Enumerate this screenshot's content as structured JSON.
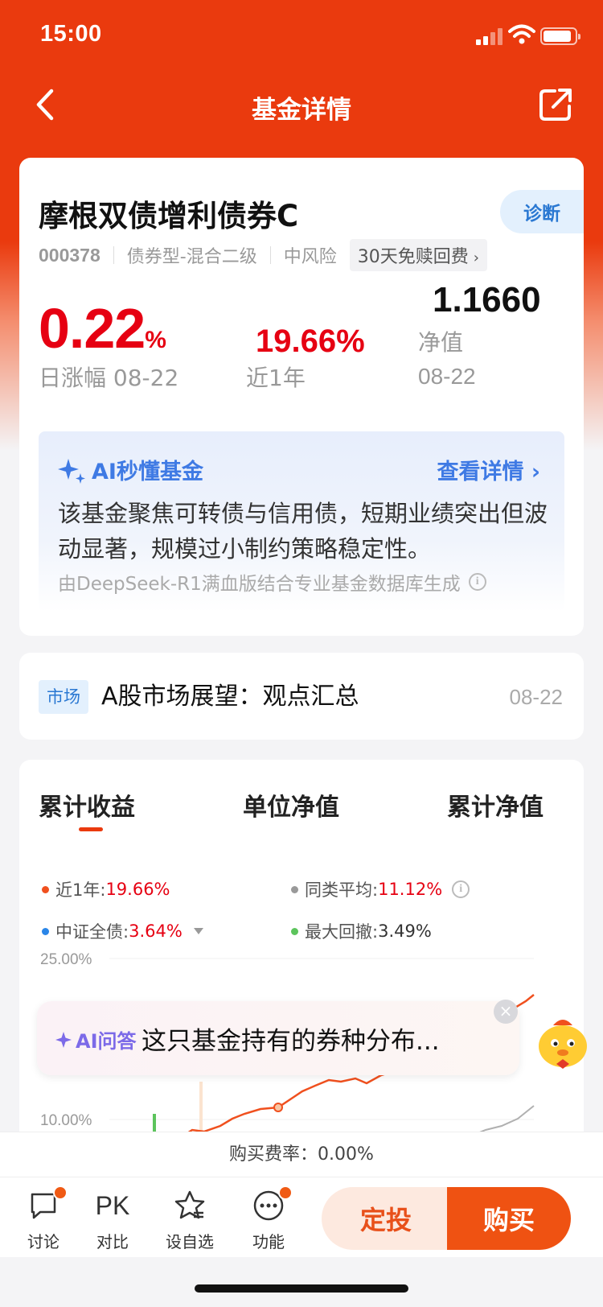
{
  "status_bar": {
    "time": "15:00"
  },
  "nav": {
    "title": "基金详情"
  },
  "fund": {
    "name": "摩根双债增利债券C",
    "diagnose_label": "诊断",
    "code": "000378",
    "type": "债券型-混合二级",
    "risk": "中风险",
    "fee_tag": "30天免赎回费",
    "daily_change": "0.22",
    "daily_change_unit": "%",
    "daily_change_label": "日涨幅 08-22",
    "year_return": "19.66%",
    "year_return_label": "近1年",
    "nav_value": "1.1660",
    "nav_label": "净值",
    "nav_date": "08-22"
  },
  "ai_summary": {
    "title": "AI秒懂基金",
    "link": "查看详情",
    "text": "该基金聚焦可转债与信用债，短期业绩突出但波动显著，规模过小制约策略稳定性。",
    "source": "由DeepSeek-R1满血版结合专业基金数据库生成"
  },
  "news": {
    "tag": "市场",
    "title": "A股市场展望：观点汇总",
    "date": "08-22"
  },
  "chart_tabs": [
    "累计收益",
    "单位净值",
    "累计净值"
  ],
  "legend": {
    "fund": {
      "label": "近1年:",
      "value": "19.66%",
      "color": "#f0501e"
    },
    "peer": {
      "label": "同类平均:",
      "value": "11.12%",
      "color": "#999999"
    },
    "index": {
      "label": "中证全债:",
      "value": "3.64%",
      "color": "#2a86e8"
    },
    "drawdown": {
      "label": "最大回撤:",
      "value": "3.49%",
      "color": "#5cc45c"
    }
  },
  "chart_data": {
    "type": "line",
    "y_tick_labels": [
      "25.00%",
      "10.00%"
    ],
    "series": [
      {
        "name": "近1年",
        "color": "#f0501e"
      },
      {
        "name": "同类平均",
        "color": "#999999"
      }
    ]
  },
  "ai_qa": {
    "label": "AI问答",
    "text": "这只基金持有的券种分布..."
  },
  "fee_bar": {
    "text": "购买费率：0.00%"
  },
  "bottom_bar": {
    "discuss": "讨论",
    "compare_icon": "PK",
    "compare": "对比",
    "watch": "设自选",
    "more": "功能",
    "sip": "定投",
    "buy": "购买"
  }
}
